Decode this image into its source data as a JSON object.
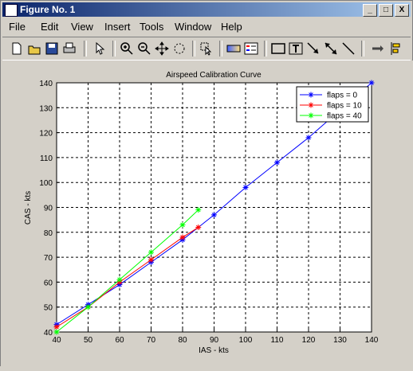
{
  "window": {
    "title": "Figure No. 1",
    "minimize": "_",
    "maximize": "□",
    "close": "X"
  },
  "menu": [
    "File",
    "Edit",
    "View",
    "Insert",
    "Tools",
    "Window",
    "Help"
  ],
  "toolbar_icons": [
    "new-figure-icon",
    "open-icon",
    "save-icon",
    "print-icon",
    "select-arrow-icon",
    "zoom-in-icon",
    "zoom-out-icon",
    "pan-icon",
    "rotate-icon",
    "data-cursor-icon",
    "colorbar-icon",
    "legend-icon",
    "rectangle-icon",
    "text-icon",
    "arrow-icon",
    "double-arrow-icon",
    "line-icon",
    "dock-icon",
    "align-icon"
  ],
  "chart_data": {
    "type": "line",
    "title": "Airspeed Calibration Curve",
    "xlabel": "IAS - kts",
    "ylabel": "CAS - kts",
    "xlim": [
      40,
      140
    ],
    "ylim": [
      40,
      140
    ],
    "xticks": [
      40,
      50,
      60,
      70,
      80,
      90,
      100,
      110,
      120,
      130,
      140
    ],
    "yticks": [
      40,
      50,
      60,
      70,
      80,
      90,
      100,
      110,
      120,
      130,
      140
    ],
    "grid": true,
    "legend_position": "top-right",
    "series": [
      {
        "name": "flaps =  0",
        "color": "#0000ff",
        "marker": "*",
        "x": [
          40,
          50,
          60,
          70,
          80,
          90,
          100,
          110,
          120,
          130,
          140
        ],
        "y": [
          43,
          51,
          59,
          68,
          77,
          87,
          98,
          108,
          118,
          129,
          140
        ]
      },
      {
        "name": "flaps = 10",
        "color": "#ff0000",
        "marker": "*",
        "x": [
          40,
          50,
          60,
          70,
          80,
          85
        ],
        "y": [
          42,
          50,
          60,
          69,
          78,
          82
        ]
      },
      {
        "name": "flaps = 40",
        "color": "#00ff00",
        "marker": "*",
        "x": [
          40,
          50,
          60,
          70,
          80,
          85
        ],
        "y": [
          40,
          50,
          61,
          72,
          83,
          89
        ]
      }
    ]
  }
}
